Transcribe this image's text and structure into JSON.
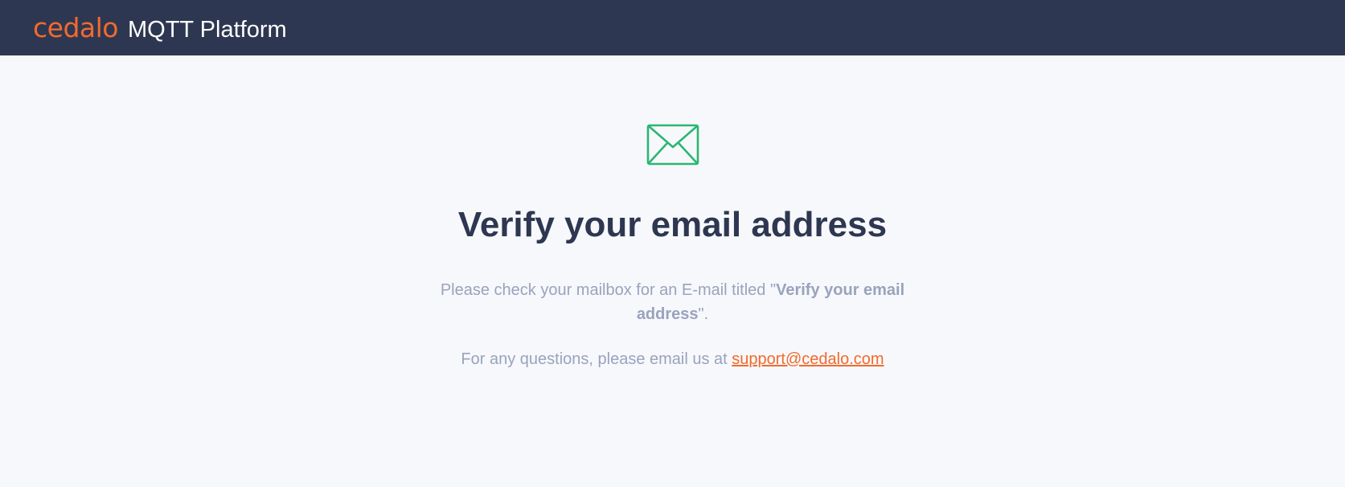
{
  "header": {
    "logo_text": "cedalo",
    "product_name": "MQTT Platform"
  },
  "main": {
    "icon": "mail-envelope-icon",
    "title": "Verify your email address",
    "instruction": {
      "prefix": "Please check your mailbox for an E-mail titled \"",
      "highlight": "Verify your email address",
      "suffix": "\"."
    },
    "contact": {
      "prefix": "For any questions, please email us at ",
      "email": "support@cedalo.com"
    }
  },
  "colors": {
    "header_bg": "#2e3751",
    "brand_orange": "#f26a2e",
    "icon_green": "#2bb673",
    "title_color": "#2e3751",
    "text_muted": "#99a3bd",
    "page_bg": "#f7f8fb"
  }
}
